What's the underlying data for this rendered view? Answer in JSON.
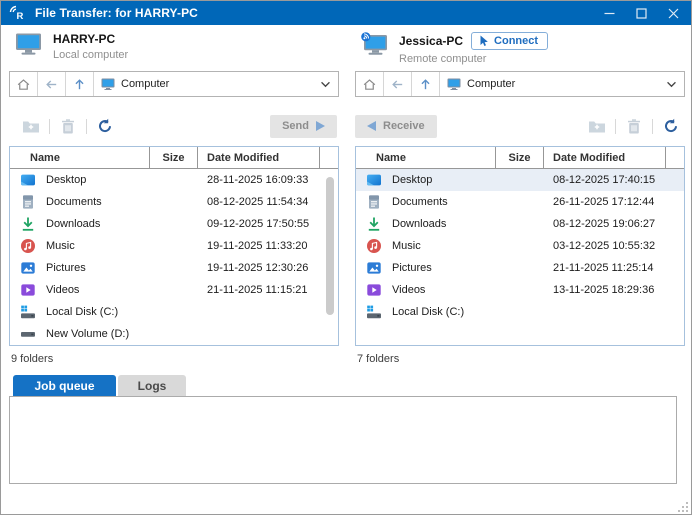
{
  "titlebar": {
    "title": "File Transfer: for HARRY-PC",
    "app_icon": "remote-signal-icon"
  },
  "colors": {
    "titlebar_blue": "#0067b8",
    "tab_active_blue": "#1572c5",
    "selected_row": "#e8eef6",
    "accent_blue": "#1f6dbf",
    "list_border": "#a6c1dd"
  },
  "panels": [
    {
      "id": "local",
      "computer_name": "HARRY-PC",
      "computer_label": "Local computer",
      "path": "Computer",
      "action_label": "Send",
      "action_direction": "send",
      "folder_count": "9 folders",
      "columns": [
        "Name",
        "Size",
        "Date Modified"
      ],
      "has_scrollbar_thumb": true,
      "files": [
        {
          "name": "Desktop",
          "icon": "desktop-folder-icon",
          "size": "",
          "date_modified": "28-11-2025 16:09:33",
          "selected": false
        },
        {
          "name": "Documents",
          "icon": "documents-folder-icon",
          "size": "",
          "date_modified": "08-12-2025 11:54:34",
          "selected": false
        },
        {
          "name": "Downloads",
          "icon": "downloads-folder-icon",
          "size": "",
          "date_modified": "09-12-2025 17:50:55",
          "selected": false
        },
        {
          "name": "Music",
          "icon": "music-folder-icon",
          "size": "",
          "date_modified": "19-11-2025 11:33:20",
          "selected": false
        },
        {
          "name": "Pictures",
          "icon": "pictures-folder-icon",
          "size": "",
          "date_modified": "19-11-2025 12:30:26",
          "selected": false
        },
        {
          "name": "Videos",
          "icon": "videos-folder-icon",
          "size": "",
          "date_modified": "21-11-2025 11:15:21",
          "selected": false
        },
        {
          "name": "Local Disk (C:)",
          "icon": "local-disk-icon",
          "size": "",
          "date_modified": "",
          "selected": false
        },
        {
          "name": "New Volume (D:)",
          "icon": "volume-icon",
          "size": "",
          "date_modified": "",
          "selected": false
        }
      ]
    },
    {
      "id": "remote",
      "computer_name": "Jessica-PC",
      "computer_label": "Remote computer",
      "connect_label": "Connect",
      "path": "Computer",
      "action_label": "Receive",
      "action_direction": "receive",
      "folder_count": "7 folders",
      "columns": [
        "Name",
        "Size",
        "Date Modified"
      ],
      "has_scrollbar_thumb": false,
      "files": [
        {
          "name": "Desktop",
          "icon": "desktop-folder-icon",
          "size": "",
          "date_modified": "08-12-2025 17:40:15",
          "selected": true
        },
        {
          "name": "Documents",
          "icon": "documents-folder-icon",
          "size": "",
          "date_modified": "26-11-2025 17:12:44",
          "selected": false
        },
        {
          "name": "Downloads",
          "icon": "downloads-folder-icon",
          "size": "",
          "date_modified": "08-12-2025 19:06:27",
          "selected": false
        },
        {
          "name": "Music",
          "icon": "music-folder-icon",
          "size": "",
          "date_modified": "03-12-2025 10:55:32",
          "selected": false
        },
        {
          "name": "Pictures",
          "icon": "pictures-folder-icon",
          "size": "",
          "date_modified": "21-11-2025 11:25:14",
          "selected": false
        },
        {
          "name": "Videos",
          "icon": "videos-folder-icon",
          "size": "",
          "date_modified": "13-11-2025 18:29:36",
          "selected": false
        },
        {
          "name": "Local Disk (C:)",
          "icon": "local-disk-icon",
          "size": "",
          "date_modified": "",
          "selected": false
        }
      ]
    }
  ],
  "bottom_tabs": [
    {
      "label": "Job queue",
      "active": true
    },
    {
      "label": "Logs",
      "active": false
    }
  ]
}
